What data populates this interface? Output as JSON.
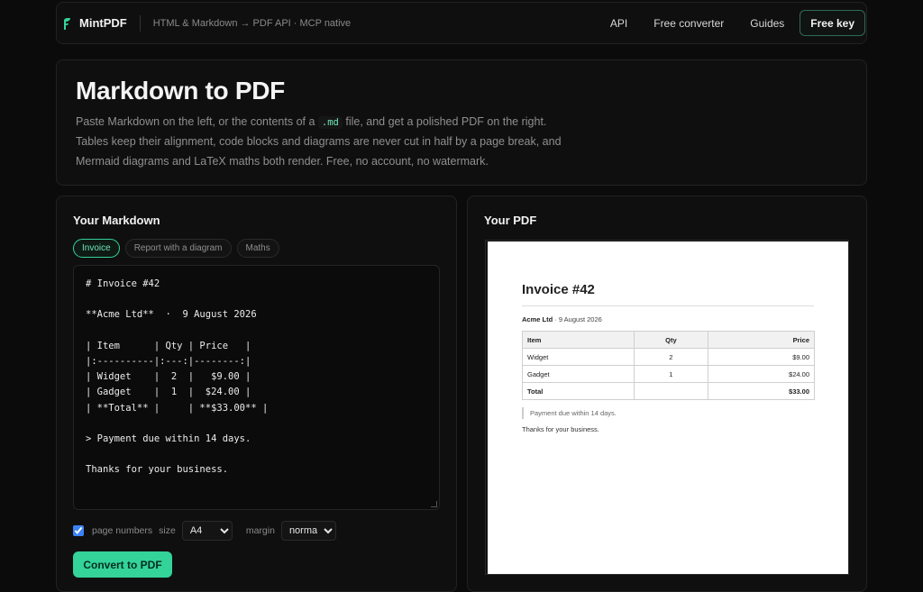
{
  "header": {
    "brand": "MintPDF",
    "tagline": "HTML & Markdown → PDF API · MCP native",
    "nav": [
      "API",
      "Free converter",
      "Guides"
    ],
    "cta": "Free key"
  },
  "hero": {
    "title": "Markdown to PDF",
    "desc_pre": "Paste Markdown on the left, or the contents of a ",
    "desc_code": ".md",
    "desc_post": " file, and get a polished PDF on the right. Tables keep their alignment, code blocks and diagrams are never cut in half by a page break, and Mermaid diagrams and LaTeX maths both render. Free, no account, no watermark."
  },
  "editor_panel": {
    "title": "Your Markdown",
    "tabs": [
      "Invoice",
      "Report with a diagram",
      "Maths"
    ],
    "active_tab": "Invoice",
    "markdown": "# Invoice #42\n\n**Acme Ltd**  ·  9 August 2026\n\n| Item      | Qty | Price   |\n|:----------|:---:|--------:|\n| Widget    |  2  |   $9.00 |\n| Gadget    |  1  |  $24.00 |\n| **Total** |     | **$33.00** |\n\n> Payment due within 14 days.\n\nThanks for your business.",
    "options": {
      "page_numbers_label": "page numbers",
      "page_numbers_checked": true,
      "size_label": "size",
      "size_value": "A4",
      "margin_label": "margin",
      "margin_value": "normal"
    },
    "convert_label": "Convert to PDF"
  },
  "pdf_panel": {
    "title": "Your PDF",
    "doc": {
      "title": "Invoice #42",
      "company": "Acme Ltd",
      "date": " · 9 August 2026",
      "headers": [
        "Item",
        "Qty",
        "Price"
      ],
      "rows": [
        [
          "Widget",
          "2",
          "$9.00"
        ],
        [
          "Gadget",
          "1",
          "$24.00"
        ]
      ],
      "total_label": "Total",
      "total_value": "$33.00",
      "note": "Payment due within 14 days.",
      "thanks": "Thanks for your business."
    }
  },
  "colors": {
    "accent": "#34d399",
    "background": "#0b0b0c"
  }
}
